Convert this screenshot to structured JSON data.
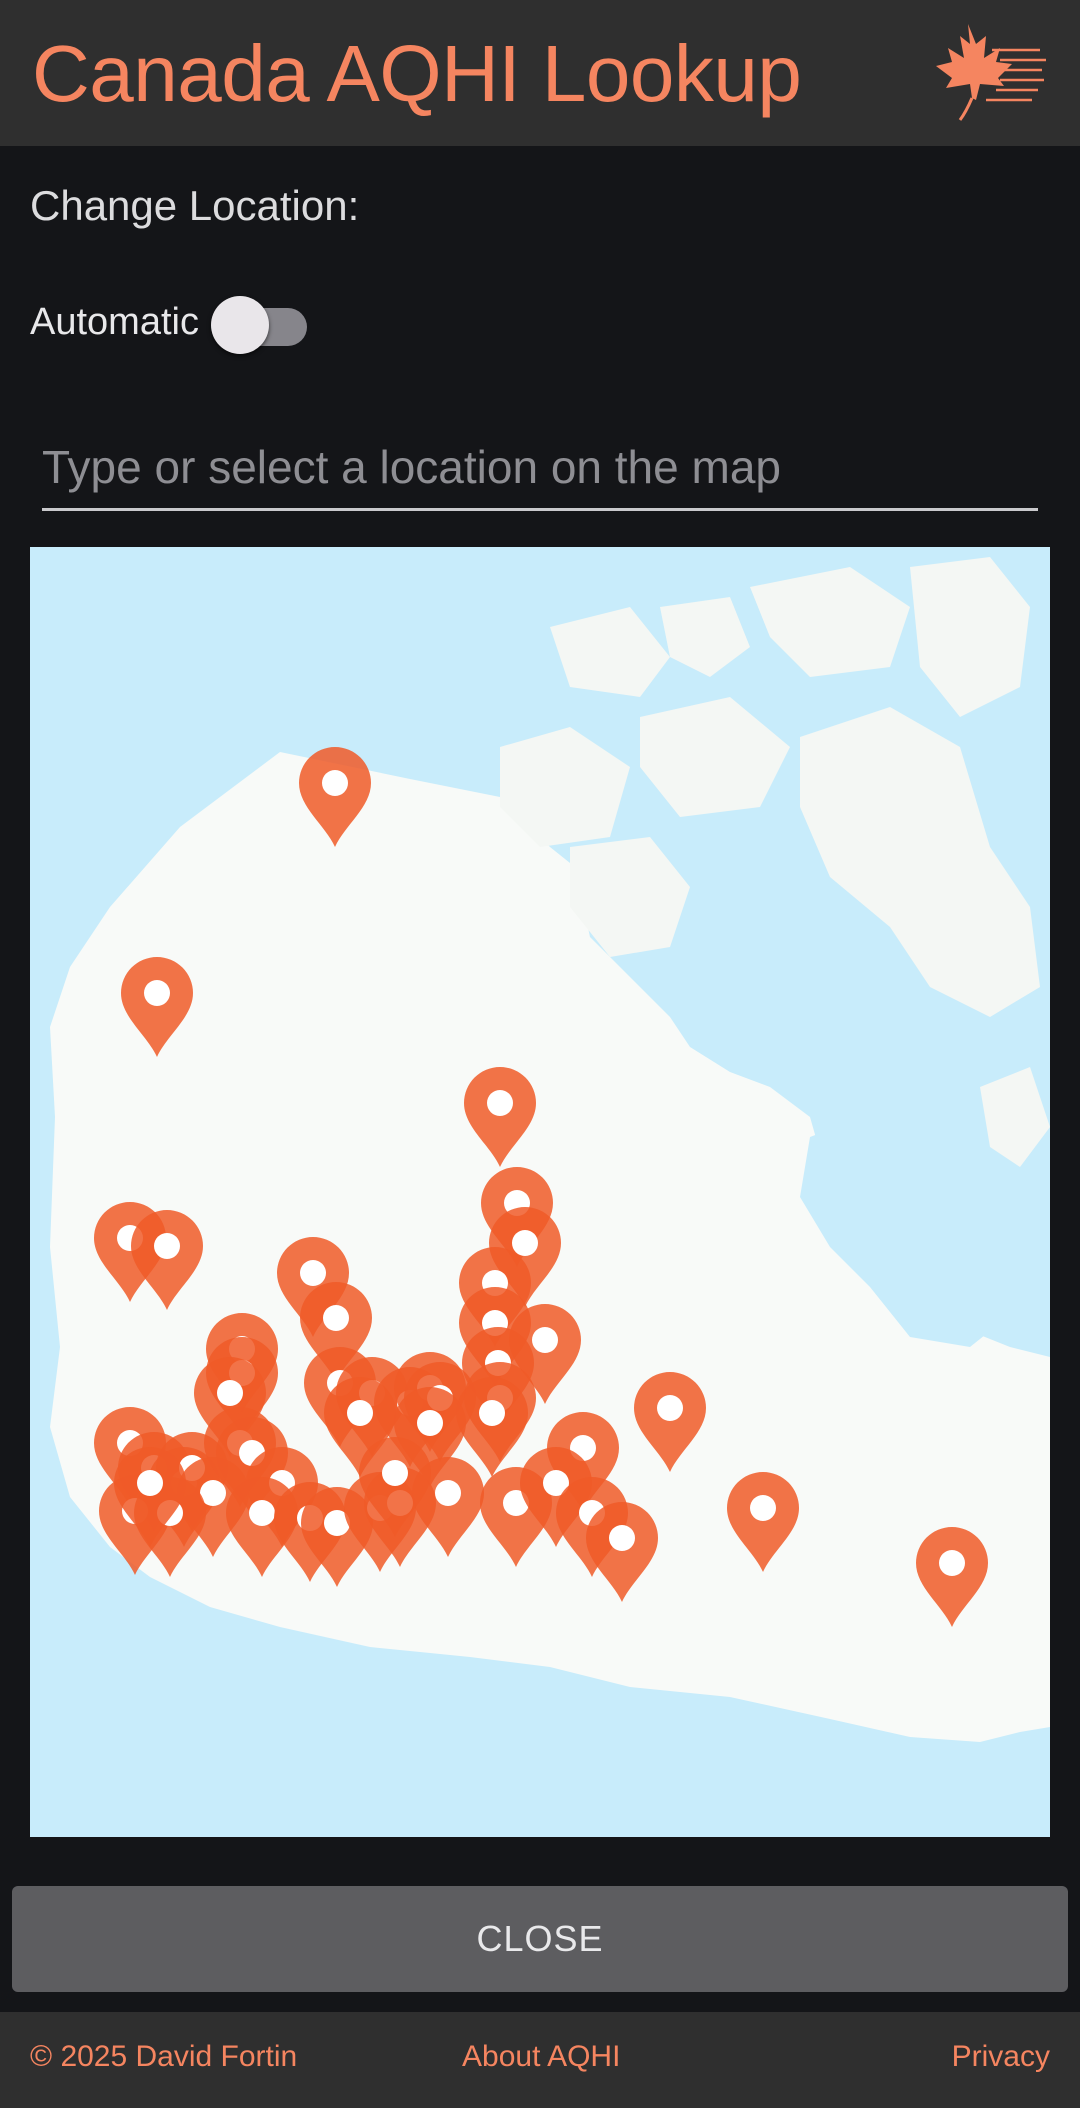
{
  "header": {
    "title": "Canada AQHI Lookup",
    "logo_icon": "maple-leaf-icon",
    "accent_color": "#f58560"
  },
  "location": {
    "label": "Change Location:",
    "automatic_label": "Automatic",
    "automatic_enabled": false
  },
  "search": {
    "value": "",
    "placeholder": "Type or select a location on the map"
  },
  "map": {
    "marker_icon": "map-pin-icon",
    "marker_color": "#f05a28",
    "water_color": "#c8ecfb",
    "land_color": "#f8faf8"
  },
  "actions": {
    "close_label": "CLOSE"
  },
  "footer": {
    "copyright": "© 2025 David Fortin",
    "about_link": "About AQHI",
    "privacy_link": "Privacy"
  }
}
